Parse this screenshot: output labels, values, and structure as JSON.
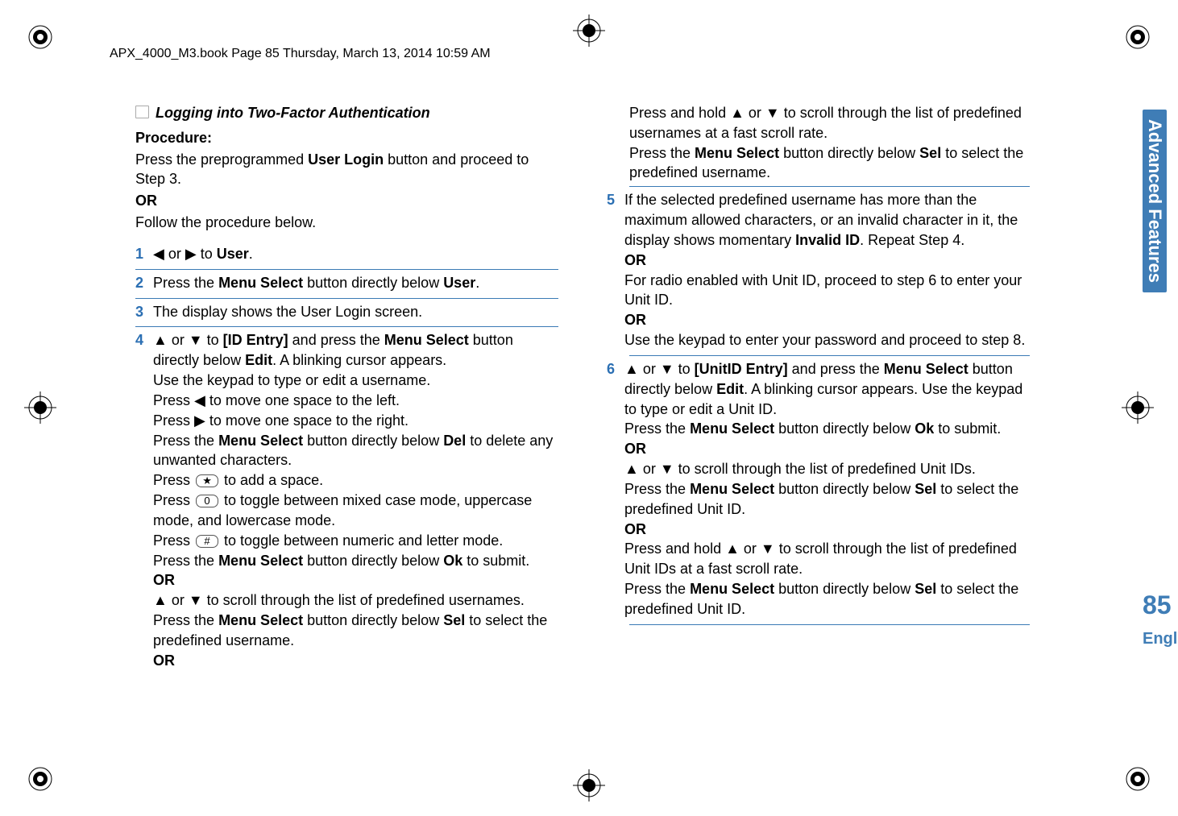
{
  "header": "APX_4000_M3.book  Page 85  Thursday, March 13, 2014  10:59 AM",
  "title": "Logging into Two-Factor Authentication",
  "proc_label": "Procedure:",
  "intro_a": "Press the preprogrammed ",
  "intro_b": "User Login",
  "intro_c": " button and proceed to Step 3.",
  "or": "OR",
  "intro_follow": "Follow the procedure below.",
  "s1": {
    "n": "1",
    "a": "◀ or ▶ to ",
    "ui": "User",
    "b": "."
  },
  "s2": {
    "n": "2",
    "a": "Press the ",
    "ms": "Menu Select",
    "b": " button directly below ",
    "ui": "User",
    "c": "."
  },
  "s3": {
    "n": "3",
    "a": "The display shows the User Login screen."
  },
  "s4": {
    "n": "4",
    "l1a": "▲ or ▼ to ",
    "l1ui1": "[ID Entry]",
    "l1b": " and press the ",
    "l1ms": "Menu Select",
    "l1c": " button directly below ",
    "l1ui2": "Edit",
    "l1d": ". A blinking cursor appears.",
    "l2": "Use the keypad to type or edit a username.",
    "l3": "Press ◀ to move one space to the left.",
    "l4": "Press ▶ to move one space to the right.",
    "l5a": "Press the ",
    "l5ms": "Menu Select",
    "l5b": " button directly below ",
    "l5ui": "Del",
    "l5c": " to delete any unwanted characters.",
    "l6a": "Press ",
    "l6key": "★",
    "l6b": " to add a space.",
    "l7a": "Press ",
    "l7key": "0",
    "l7b": " to toggle between mixed case mode, uppercase mode, and lowercase mode.",
    "l8a": "Press ",
    "l8key": "#",
    "l8b": " to toggle between numeric and letter mode.",
    "l9a": "Press the ",
    "l9ms": "Menu Select",
    "l9b": " button directly below ",
    "l9ui": "Ok",
    "l9c": " to submit.",
    "l10": "OR",
    "l11": "▲ or ▼ to scroll through the list of predefined usernames.",
    "l12a": "Press the ",
    "l12ms": "Menu Select",
    "l12b": " button directly below ",
    "l12ui": "Sel",
    "l12c": " to select the predefined username.",
    "l13": "OR"
  },
  "s4r": {
    "r1": "Press and hold ▲ or ▼ to scroll through the list of predefined usernames at a fast scroll rate.",
    "r2a": "Press the ",
    "r2ms": "Menu Select",
    "r2b": " button directly below ",
    "r2ui": "Sel",
    "r2c": " to select the predefined username."
  },
  "s5": {
    "n": "5",
    "l1a": "If the selected predefined username has more than the maximum allowed characters, or an invalid character in it, the display shows momentary ",
    "l1ui": "Invalid ID",
    "l1b": ". Repeat Step 4.",
    "l2": "OR",
    "l3": "For radio enabled with Unit ID, proceed to step 6 to enter your Unit ID.",
    "l4": "OR",
    "l5": "Use the keypad to enter your password and proceed to step 8."
  },
  "s6": {
    "n": "6",
    "l1a": "▲ or ▼ to ",
    "l1ui1": "[UnitID Entry]",
    "l1b": " and press the ",
    "l1ms": "Menu Select",
    "l1c": " button directly below ",
    "l1ui2": "Edit",
    "l1d": ". A blinking cursor appears. Use the keypad to type or edit a Unit ID.",
    "l2a": "Press the ",
    "l2ms": "Menu Select",
    "l2b": " button directly below ",
    "l2ui": "Ok",
    "l2c": " to submit.",
    "l3": "OR",
    "l4": "▲ or ▼ to scroll through the list of predefined Unit IDs.",
    "l5a": "Press the ",
    "l5ms": "Menu Select",
    "l5b": " button directly below ",
    "l5ui": "Sel",
    "l5c": " to select the predefined Unit ID.",
    "l6": "OR",
    "l7": "Press and hold ▲ or ▼ to scroll through the list of predefined Unit IDs at a fast scroll rate.",
    "l8a": "Press the ",
    "l8ms": "Menu Select",
    "l8b": " button directly below ",
    "l8ui": "Sel",
    "l8c": " to select the predefined Unit ID."
  },
  "sidebar_title": "Advanced Features",
  "page_num": "85",
  "language": "English"
}
